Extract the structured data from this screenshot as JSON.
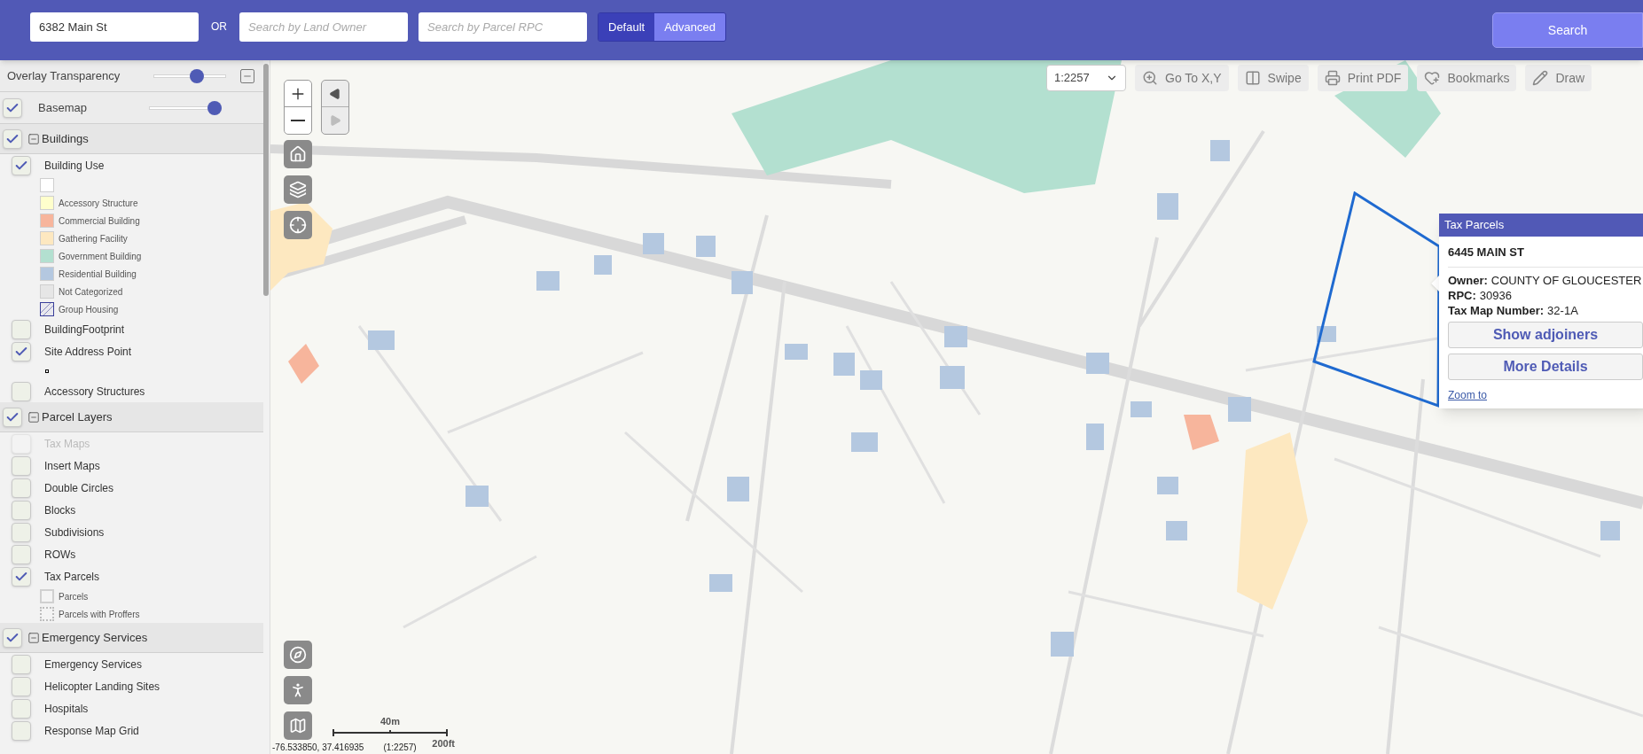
{
  "header": {
    "address_field": {
      "value": "6382 Main St"
    },
    "or_label": "OR",
    "owner_field": {
      "placeholder": "Search by Land Owner"
    },
    "rpc_field": {
      "placeholder": "Search by Parcel RPC"
    },
    "modes": [
      {
        "label": "Default",
        "selected": true
      },
      {
        "label": "Advanced",
        "selected": false
      }
    ],
    "search_button": "Search"
  },
  "sidebar": {
    "overlay_transparency": {
      "label": "Overlay Transparency",
      "level": 0.6
    },
    "basemap": {
      "label": "Basemap",
      "checked": true,
      "level": 0.9
    },
    "groups": [
      {
        "label": "Buildings",
        "checked": true,
        "expanded": true,
        "items": [
          {
            "label": "Building Use",
            "checked": true,
            "disabled": false,
            "legend": [
              {
                "kind": "fill",
                "color": "#ffffff"
              },
              {
                "label": "Accessory Structure",
                "kind": "fill",
                "color": "#ffffcc"
              },
              {
                "label": "Commercial Building",
                "kind": "fill",
                "color": "#f7b59c"
              },
              {
                "label": "Gathering Facility",
                "kind": "fill",
                "color": "#fde8c0"
              },
              {
                "label": "Government Building",
                "kind": "fill",
                "color": "#b3e0d0"
              },
              {
                "label": "Residential Building",
                "kind": "fill",
                "color": "#b4c8e0"
              },
              {
                "label": "Not Categorized",
                "kind": "fill",
                "color": "#e6e6e6"
              },
              {
                "label": "Group Housing",
                "kind": "hatch"
              }
            ]
          },
          {
            "label": "BuildingFootprint",
            "checked": false,
            "disabled": false
          },
          {
            "label": "Site Address Point",
            "checked": true,
            "disabled": false,
            "legend": [
              {
                "kind": "point"
              }
            ]
          },
          {
            "label": "Accessory Structures",
            "checked": false,
            "disabled": false
          }
        ]
      },
      {
        "label": "Parcel Layers",
        "checked": true,
        "expanded": true,
        "items": [
          {
            "label": "Tax Maps",
            "checked": false,
            "disabled": true
          },
          {
            "label": "Insert Maps",
            "checked": false,
            "disabled": false
          },
          {
            "label": "Double Circles",
            "checked": false,
            "disabled": false
          },
          {
            "label": "Blocks",
            "checked": false,
            "disabled": false
          },
          {
            "label": "Subdivisions",
            "checked": false,
            "disabled": false
          },
          {
            "label": "ROWs",
            "checked": false,
            "disabled": false
          },
          {
            "label": "Tax Parcels",
            "checked": true,
            "disabled": false,
            "legend": [
              {
                "label": "Parcels",
                "kind": "outline"
              },
              {
                "label": "Parcels with Proffers",
                "kind": "dotted"
              }
            ]
          }
        ]
      },
      {
        "label": "Emergency Services",
        "checked": true,
        "expanded": true,
        "items": [
          {
            "label": "Emergency Services",
            "checked": false,
            "disabled": false
          },
          {
            "label": "Helicopter Landing Sites",
            "checked": false,
            "disabled": false
          },
          {
            "label": "Hospitals",
            "checked": false,
            "disabled": false
          },
          {
            "label": "Response Map Grid",
            "checked": false,
            "disabled": false
          }
        ]
      }
    ]
  },
  "map": {
    "history": [
      {
        "kind": "back",
        "disabled": false
      },
      {
        "kind": "forward",
        "disabled": true
      }
    ],
    "scale_select": "1:2257",
    "tools": [
      {
        "label": "Go To X,Y",
        "kind": "goto"
      },
      {
        "label": "Swipe",
        "kind": "swipe"
      },
      {
        "label": "Print PDF",
        "kind": "print"
      },
      {
        "label": "Bookmarks",
        "kind": "bookmarks"
      },
      {
        "label": "Draw",
        "kind": "draw"
      }
    ],
    "scale_bar": {
      "metric": "40m",
      "imperial": "200ft"
    },
    "coordinates": "-76.533850, 37.416935",
    "scale_text": "(1:2257)",
    "popup": {
      "title": "Tax Parcels",
      "address": "6445 MAIN ST",
      "fields": [
        {
          "label": "Owner:",
          "value": "COUNTY OF GLOUCESTER"
        },
        {
          "label": "RPC:",
          "value": "30936"
        },
        {
          "label": "Tax Map Number:",
          "value": "32-1A"
        }
      ],
      "buttons": [
        "Show adjoiners",
        "More Details"
      ],
      "link": "Zoom to"
    }
  }
}
